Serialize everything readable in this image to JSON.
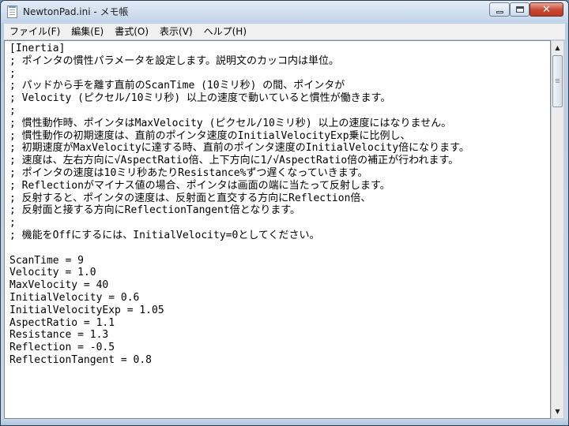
{
  "window": {
    "title": "NewtonPad.ini - メモ帳",
    "minimize_icon": "minimize-icon",
    "maximize_icon": "maximize-icon",
    "close_icon": "close-icon",
    "close_glyph": "✕"
  },
  "menu": {
    "items": [
      {
        "label": "ファイル(F)"
      },
      {
        "label": "編集(E)"
      },
      {
        "label": "書式(O)"
      },
      {
        "label": "表示(V)"
      },
      {
        "label": "ヘルプ(H)"
      }
    ]
  },
  "document": {
    "lines": [
      "[Inertia]",
      "; ポインタの慣性パラメータを設定します。説明文のカッコ内は単位。",
      ";",
      "; パッドから手を離す直前のScanTime (10ミリ秒) の間、ポインタが",
      "; Velocity (ピクセル/10ミリ秒) 以上の速度で動いていると慣性が働きます。",
      ";",
      "; 慣性動作時、ポインタはMaxVelocity (ピクセル/10ミリ秒) 以上の速度にはなりません。",
      "; 慣性動作の初期速度は、直前のポインタ速度のInitialVelocityExp乗に比例し、",
      "; 初期速度がMaxVelocityに達する時、直前のポインタ速度のInitialVelocity倍になります。",
      "; 速度は、左右方向に√AspectRatio倍、上下方向に1/√AspectRatio倍の補正が行われます。",
      "; ポインタの速度は10ミリ秒あたりResistance%ずつ遅くなっていきます。",
      "; Reflectionがマイナス値の場合、ポインタは画面の端に当たって反射します。",
      "; 反射すると、ポインタの速度は、反射面と直交する方向にReflection倍、",
      "; 反射面と接する方向にReflectionTangent倍となります。",
      ";",
      "; 機能をOffにするには、InitialVelocity=0としてください。",
      "",
      "ScanTime = 9",
      "Velocity = 1.0",
      "MaxVelocity = 40",
      "InitialVelocity = 0.6",
      "InitialVelocityExp = 1.05",
      "AspectRatio = 1.1",
      "Resistance = 1.3",
      "Reflection = -0.5",
      "ReflectionTangent = 0.8"
    ]
  },
  "scrollbar": {
    "up_arrow": "▲",
    "down_arrow": "▼",
    "position": 0
  }
}
